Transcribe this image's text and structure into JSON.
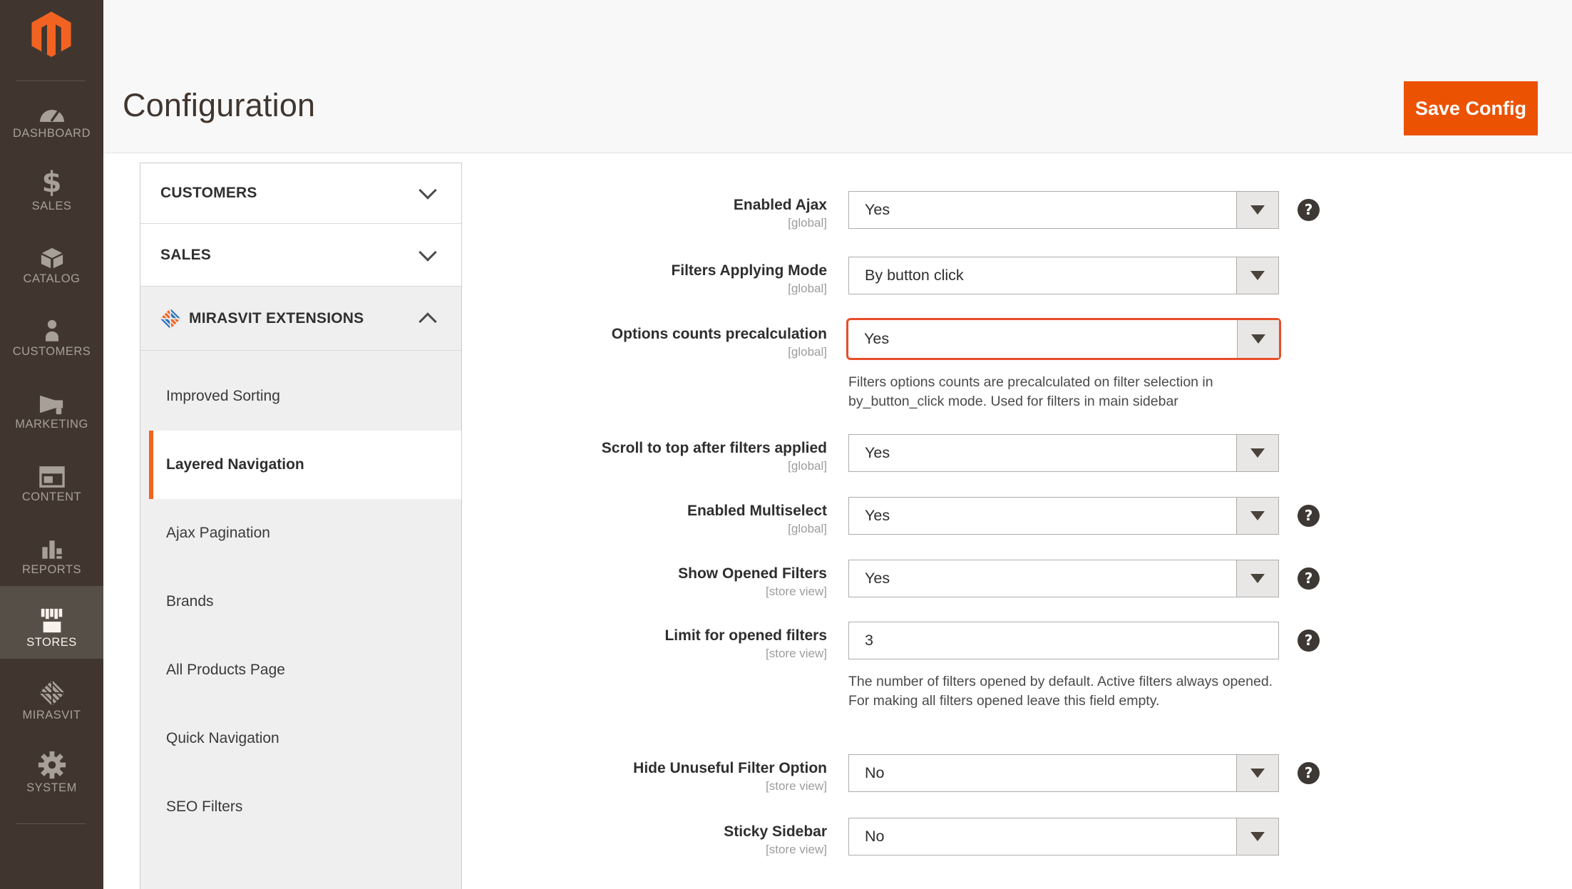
{
  "colors": {
    "accent_orange": "#eb5202",
    "logo_orange": "#f26322",
    "highlight_border": "#e84d2a",
    "sidebar_bg": "#41362f",
    "sidebar_active_bg": "#564f47",
    "header_bg": "#f8f8f8",
    "panel_gray": "#efefef",
    "border_gray": "#cccccc",
    "mirasvit_blue": "#2a70b8"
  },
  "header": {
    "title": "Configuration",
    "save_button_label": "Save Config"
  },
  "sidebar": {
    "items": [
      {
        "label": "DASHBOARD",
        "icon": "dashboard-icon",
        "active": false
      },
      {
        "label": "SALES",
        "icon": "sales-icon",
        "active": false
      },
      {
        "label": "CATALOG",
        "icon": "catalog-icon",
        "active": false
      },
      {
        "label": "CUSTOMERS",
        "icon": "customers-icon",
        "active": false
      },
      {
        "label": "MARKETING",
        "icon": "marketing-icon",
        "active": false
      },
      {
        "label": "CONTENT",
        "icon": "content-icon",
        "active": false
      },
      {
        "label": "REPORTS",
        "icon": "reports-icon",
        "active": false
      },
      {
        "label": "STORES",
        "icon": "stores-icon",
        "active": true
      },
      {
        "label": "MIRASVIT",
        "icon": "mirasvit-icon",
        "active": false
      },
      {
        "label": "SYSTEM",
        "icon": "system-icon",
        "active": false
      }
    ]
  },
  "config_nav": {
    "sections": [
      {
        "label": "CUSTOMERS",
        "expanded": false
      },
      {
        "label": "SALES",
        "expanded": false
      },
      {
        "label": "MIRASVIT EXTENSIONS",
        "expanded": true,
        "icon": "mirasvit-logo-icon"
      }
    ],
    "items": [
      {
        "label": "Improved Sorting",
        "active": false
      },
      {
        "label": "Layered Navigation",
        "active": true
      },
      {
        "label": "Ajax Pagination",
        "active": false
      },
      {
        "label": "Brands",
        "active": false
      },
      {
        "label": "All Products Page",
        "active": false
      },
      {
        "label": "Quick Navigation",
        "active": false
      },
      {
        "label": "SEO Filters",
        "active": false
      }
    ]
  },
  "form": {
    "help_glyph": "?",
    "fields": [
      {
        "label": "Enabled Ajax",
        "scope": "[global]",
        "value": "Yes",
        "control": "select",
        "help": true,
        "highlighted": false
      },
      {
        "label": "Filters Applying Mode",
        "scope": "[global]",
        "value": "By button click",
        "control": "select",
        "help": false,
        "highlighted": false
      },
      {
        "label": "Options counts precalculation",
        "scope": "[global]",
        "value": "Yes",
        "control": "select",
        "help": false,
        "highlighted": true,
        "note": "Filters options counts are precalculated on filter selection in by_button_click mode. Used for filters in main sidebar"
      },
      {
        "label": "Scroll to top after filters applied",
        "scope": "[global]",
        "value": "Yes",
        "control": "select",
        "help": false,
        "highlighted": false
      },
      {
        "label": "Enabled Multiselect",
        "scope": "[global]",
        "value": "Yes",
        "control": "select",
        "help": true,
        "highlighted": false
      },
      {
        "label": "Show Opened Filters",
        "scope": "[store view]",
        "value": "Yes",
        "control": "select",
        "help": true,
        "highlighted": false
      },
      {
        "label": "Limit for opened filters",
        "scope": "[store view]",
        "value": "3",
        "control": "text",
        "help": true,
        "highlighted": false,
        "note_line1": "The number of filters opened by default. Active filters always opened.",
        "note_line2": "For making all filters opened leave this field empty."
      },
      {
        "label": "Hide Unuseful Filter Option",
        "scope": "[store view]",
        "value": "No",
        "control": "select",
        "help": true,
        "highlighted": false
      },
      {
        "label": "Sticky Sidebar",
        "scope": "[store view]",
        "value": "No",
        "control": "select",
        "help": false,
        "highlighted": false
      }
    ]
  }
}
